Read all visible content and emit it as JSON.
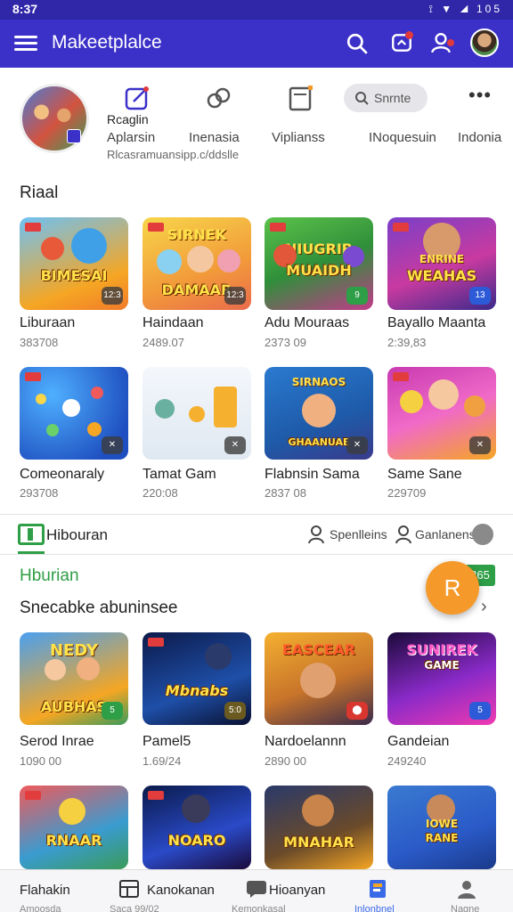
{
  "status_bar": {
    "time": "8:37",
    "icons": "⟟ ▼ ◢ 105"
  },
  "app_bar": {
    "title": "Makeetplalce"
  },
  "profile": {
    "name": "Rcaglin",
    "subtitle": "Rlcasramuansipp.c/ddslle",
    "quick_actions": [
      {
        "label": "Aplarsin",
        "icon": "edit-icon"
      },
      {
        "label": "Inenasia",
        "icon": "link-icon"
      },
      {
        "label": "Viplianss",
        "icon": "document-icon"
      },
      {
        "label": "INoquesuin",
        "icon": "search-icon"
      },
      {
        "label": "Indonia",
        "icon": "more-icon"
      }
    ],
    "search_placeholder": "Snrnte",
    "more_label": "•••"
  },
  "section1": {
    "title": "Riaal",
    "rows": [
      [
        {
          "art_text": "BIMESAI",
          "name": "Liburaan",
          "sub": "383708",
          "corner": "12:3"
        },
        {
          "art_text": "DAMAAR",
          "art_top": "SIRNEK",
          "name": "Haindaan",
          "sub": "2489.07",
          "corner": "12:3"
        },
        {
          "art_text": "MUAIDH",
          "art_top": "NIUGRIB",
          "name": "Adu Mouraas",
          "sub": "2373 09",
          "corner": "9"
        },
        {
          "art_text": "WEAHAS",
          "art_top": "ENRINE",
          "name": "Bayallo Maanta",
          "sub": "2:39,83",
          "corner": "13"
        }
      ],
      [
        {
          "art_text": "",
          "name": "Comeonaraly",
          "sub": "293708",
          "corner": "✕"
        },
        {
          "art_text": "",
          "name": "Tamat Gam",
          "sub": "220:08",
          "corner": "✕"
        },
        {
          "art_text": "GHAANUAE",
          "art_top": "SIRNAOS",
          "name": "Flabnsin Sama",
          "sub": "2837 08",
          "corner": "✕"
        },
        {
          "art_text": "",
          "name": "Same Sane",
          "sub": "229709",
          "corner": "✕"
        }
      ]
    ]
  },
  "hiburan_bar": {
    "label": "Hibouran",
    "link1": "Spenlleins",
    "link2": "Ganlanens"
  },
  "section2": {
    "title": "Hburian",
    "subtitle": "Snecabke abuninsee",
    "badge": "365",
    "fab_label": "R",
    "rows": [
      [
        {
          "art_text": "AUBHAS",
          "art_top": "NEDY",
          "name": "Serod Inrae",
          "sub": "1090 00",
          "corner": "5"
        },
        {
          "art_text": "Mbnabs",
          "name": "Pamel5",
          "sub": "1.69/24",
          "corner": "5:0"
        },
        {
          "art_text": "",
          "art_top": "EASCEAR",
          "name": "Nardoelannn",
          "sub": "2890 00",
          "corner": "⬤"
        },
        {
          "art_text": "GAME",
          "art_top": "SUNIREK",
          "name": "Gandeian",
          "sub": "249240",
          "corner": "5"
        }
      ],
      [
        {
          "art_text": "RNAAR",
          "name": "",
          "sub": "",
          "corner": ""
        },
        {
          "art_text": "NOARO",
          "name": "",
          "sub": "",
          "corner": ""
        },
        {
          "art_text": "MNAHAR",
          "name": "",
          "sub": "",
          "corner": ""
        },
        {
          "art_text": "RANE",
          "art_top": "IOWE",
          "name": "",
          "sub": "",
          "corner": ""
        }
      ]
    ]
  },
  "bottom_nav": [
    {
      "label": "Flahakin",
      "sub": "Amoosda",
      "icon": ""
    },
    {
      "label": "Kanokanan",
      "sub": "Saca 99/02",
      "icon": "grid-icon"
    },
    {
      "label": "Hioanyan",
      "sub": "Kemonkasal",
      "icon": "chat-icon"
    },
    {
      "label": "",
      "sub": "Inlonbnel",
      "icon": "bookmark-icon"
    },
    {
      "label": "",
      "sub": "Nagne",
      "icon": "person-icon"
    }
  ],
  "colors": {
    "brand": "#3b30c8",
    "green": "#2e9e47",
    "fab": "#f59a2a"
  }
}
